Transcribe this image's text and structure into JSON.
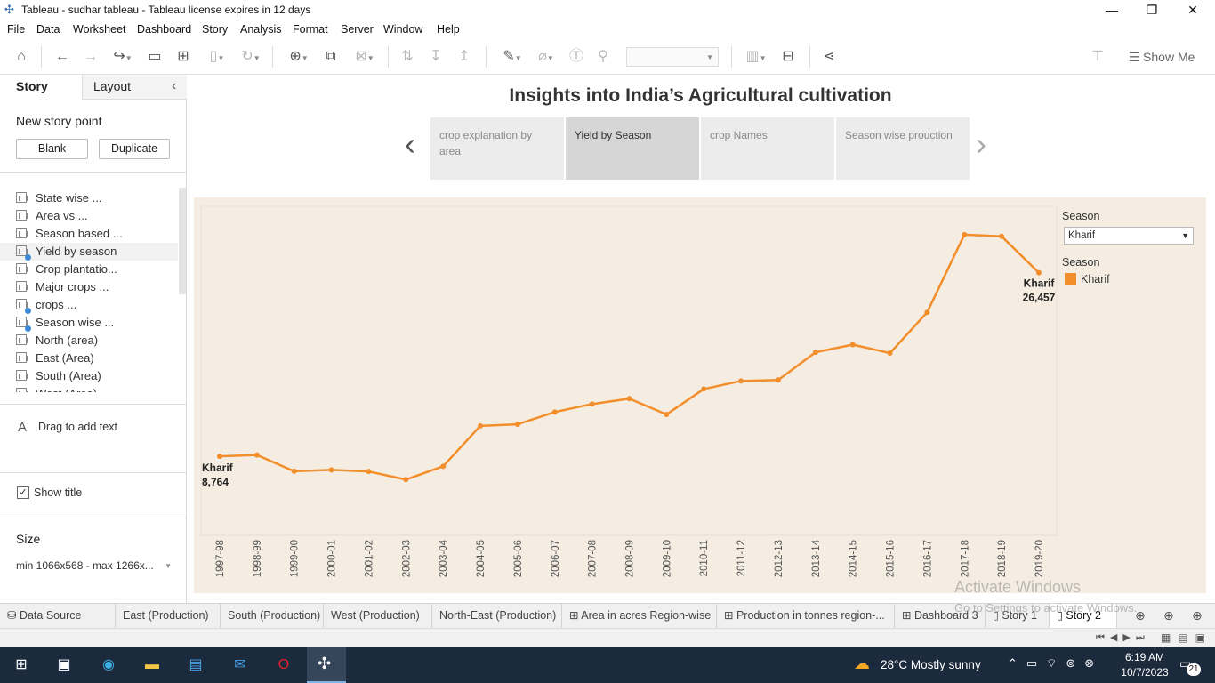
{
  "window": {
    "title": "Tableau - sudhar tableau - Tableau license expires in 12 days",
    "min": "—",
    "max": "❐",
    "close": "✕"
  },
  "menu": [
    "File",
    "Data",
    "Worksheet",
    "Dashboard",
    "Story",
    "Analysis",
    "Format",
    "Server",
    "Window",
    "Help"
  ],
  "toolbar": {
    "show_me": "Show Me"
  },
  "left": {
    "tab_story": "Story",
    "tab_layout": "Layout",
    "collapse": "‹",
    "new_story_point": "New story point",
    "blank": "Blank",
    "duplicate": "Duplicate",
    "sheets": [
      {
        "label": "State wise ...",
        "checked": false
      },
      {
        "label": "Area vs ...",
        "checked": false
      },
      {
        "label": "Season based ...",
        "checked": false
      },
      {
        "label": "Yield by season",
        "checked": true
      },
      {
        "label": "Crop plantatio...",
        "checked": false
      },
      {
        "label": "Major crops ...",
        "checked": false
      },
      {
        "label": "crops ...",
        "checked": true
      },
      {
        "label": "Season wise ...",
        "checked": true
      },
      {
        "label": "North (area)",
        "checked": false
      },
      {
        "label": "East (Area)",
        "checked": false
      },
      {
        "label": "South (Area)",
        "checked": false
      },
      {
        "label": "West (Area)",
        "checked": false
      }
    ],
    "drag_text": "Drag to add text",
    "drag_icon": "A",
    "show_title": "Show title",
    "size_label": "Size",
    "size_value": "min 1066x568 - max 1266x..."
  },
  "story": {
    "title": "Insights into India’s Agricultural cultivation",
    "points": [
      {
        "label": "crop explanation by area",
        "active": false
      },
      {
        "label": "Yield by Season",
        "active": true
      },
      {
        "label": "crop Names",
        "active": false
      },
      {
        "label": "Season wise prouction",
        "active": false
      }
    ],
    "prev": "‹",
    "next": "›"
  },
  "filter": {
    "title": "Season",
    "value": "Kharif",
    "legend_title": "Season",
    "legend_item": "Kharif",
    "legend_color": "#f28e2b"
  },
  "chart_data": {
    "type": "line",
    "x": [
      "1997-98",
      "1998-99",
      "1999-00",
      "2000-01",
      "2001-02",
      "2002-03",
      "2003-04",
      "2004-05",
      "2005-06",
      "2006-07",
      "2007-08",
      "2008-09",
      "2009-10",
      "2010-11",
      "2011-12",
      "2012-13",
      "2013-14",
      "2014-15",
      "2015-16",
      "2016-17",
      "2017-18",
      "2018-19",
      "2019-20"
    ],
    "series": [
      {
        "name": "Kharif",
        "color": "#f28e2b",
        "values": [
          8764,
          8890,
          7320,
          7450,
          7300,
          6520,
          7800,
          11700,
          11850,
          13030,
          13800,
          14320,
          12800,
          15250,
          16030,
          16120,
          18790,
          19530,
          18710,
          22640,
          30130,
          29960,
          26457
        ]
      }
    ],
    "start_label": {
      "name": "Kharif",
      "value": "8,764"
    },
    "end_label": {
      "name": "Kharif",
      "value": "26,457"
    },
    "ylim": [
      2000,
      32000
    ],
    "grid": false,
    "legend": "top-right"
  },
  "tabs": [
    {
      "label": "Data Source",
      "icon": "database-icon",
      "active": false
    },
    {
      "label": "East (Production)",
      "icon": "",
      "active": false
    },
    {
      "label": "South (Production)",
      "icon": "",
      "active": false
    },
    {
      "label": "West (Production)",
      "icon": "",
      "active": false
    },
    {
      "label": "North-East (Production)",
      "icon": "",
      "active": false
    },
    {
      "label": "Area in acres Region-wise",
      "icon": "dashboard-icon",
      "active": false
    },
    {
      "label": "Production in tonnes region-...",
      "icon": "dashboard-icon",
      "active": false
    },
    {
      "label": "Dashboard 3",
      "icon": "dashboard-icon",
      "active": false
    },
    {
      "label": "Story 1",
      "icon": "story-icon",
      "active": false
    },
    {
      "label": "Story 2",
      "icon": "story-icon",
      "active": true
    }
  ],
  "watermark": {
    "line1": "Activate Windows",
    "line2": "Go to Settings to activate Windows."
  },
  "taskbar": {
    "weather": "28°C  Mostly sunny",
    "time": "6:19 AM",
    "date": "10/7/2023",
    "notif": "21"
  }
}
